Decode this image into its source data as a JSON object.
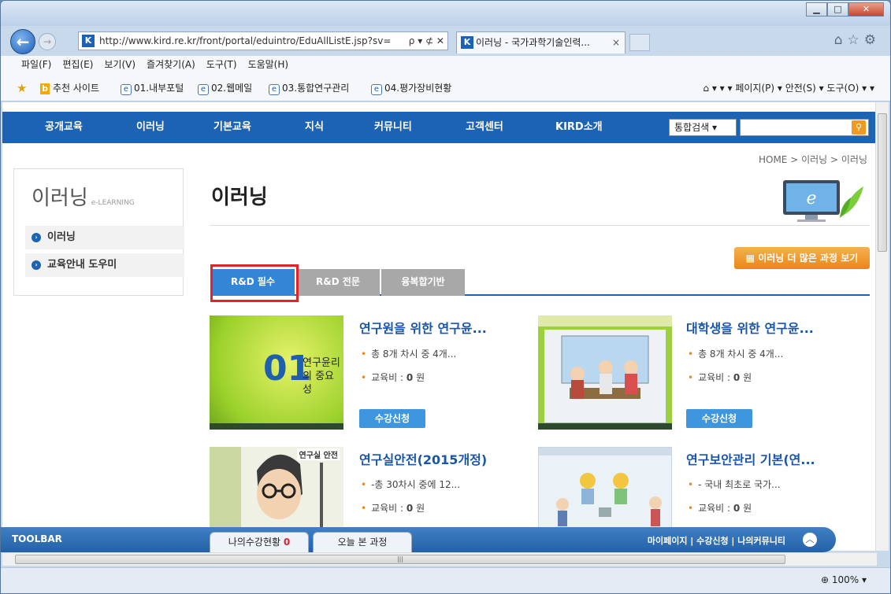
{
  "browser": {
    "url": "http://www.kird.re.kr/front/portal/eduintro/EduAllListE.jsp?sv=",
    "url_controls": "ρ ▾ ⊄ ✕",
    "tab_title": "이러닝 - 국가과학기술인력...",
    "tab_close": "×",
    "menu": [
      "파일(F)",
      "편집(E)",
      "보기(V)",
      "즐겨찾기(A)",
      "도구(T)",
      "도움말(H)"
    ],
    "favorites": [
      "추천 사이트",
      "01.내부포털",
      "02.웹메일",
      "03.통합연구관리",
      "04.평가장비현황"
    ],
    "commands": "▾ ▾ ▾ 페이지(P) ▾ 안전(S) ▾ 도구(O) ▾ ▾",
    "zoom": "100%"
  },
  "site": {
    "nav": [
      "공개교육",
      "이러닝",
      "기본교육",
      "지식",
      "커뮤니티",
      "고객센터",
      "KIRD소개"
    ],
    "search_select": "통합검색",
    "breadcrumb": "HOME > 이러닝 > 이러닝",
    "sidebar": {
      "title": "이러닝",
      "subtitle": "e-LEARNING",
      "items": [
        "이러닝",
        "교육안내 도우미"
      ]
    },
    "page_title": "이러닝",
    "more_button": "이러닝 더 많은 과정 보기",
    "tabs": [
      "R&D 필수",
      "R&D 전문",
      "융복합기반"
    ],
    "courses": [
      {
        "title": "연구원을 위한 연구윤...",
        "info": "총 8개 차시 중 4개...",
        "fee_label": "교육비 : ",
        "fee": "0",
        "fee_unit": "원",
        "apply": "수강신청",
        "thumb_text": "01",
        "thumb_sub": "연구윤리의 중요성"
      },
      {
        "title": "대학생을 위한 연구윤...",
        "info": "총 8개 차시 중 4개...",
        "fee_label": "교육비 : ",
        "fee": "0",
        "fee_unit": "원",
        "apply": "수강신청"
      },
      {
        "title": "연구실안전(2015개정)",
        "info": "-총 30차시 중에 12...",
        "fee_label": "교육비 : ",
        "fee": "0",
        "fee_unit": "원",
        "thumb_label": "연구실 안전"
      },
      {
        "title": "연구보안관리 기본(연...",
        "info": "- 국내 최초로 국가...",
        "fee_label": "교육비 : ",
        "fee": "0",
        "fee_unit": "원"
      }
    ],
    "toolbar": {
      "label": "TOOLBAR",
      "tab1": "나의수강현황",
      "tab1_count": "0",
      "tab2": "오늘 본 과정",
      "links": "마이페이지 | 수강신청 | 나의커뮤니티"
    }
  }
}
